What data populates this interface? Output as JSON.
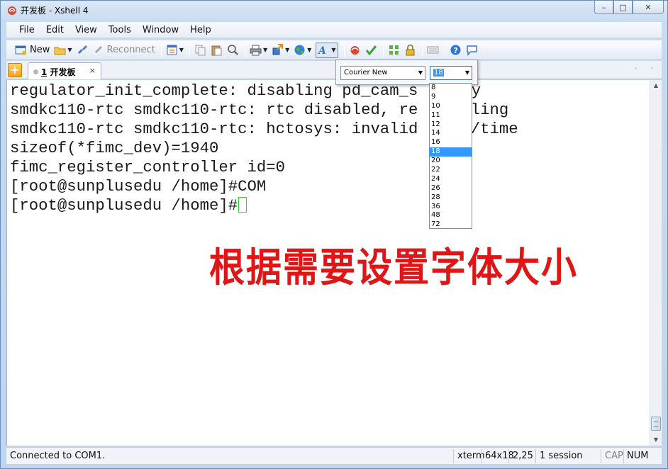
{
  "window": {
    "title": "开发板 - Xshell 4",
    "controls": {
      "minimize": "–",
      "maximize": "□",
      "close": "✕"
    }
  },
  "menu": [
    "File",
    "Edit",
    "View",
    "Tools",
    "Window",
    "Help"
  ],
  "toolbar": {
    "new_label": "New",
    "reconnect_label": "Reconnect"
  },
  "tabs": {
    "add_label": "+",
    "active": {
      "number": "1",
      "name": "开发板",
      "close": "×"
    },
    "nav": "‹ ›"
  },
  "terminal": {
    "lines": [
      "regulator_init_complete: disabling pd_cam_s",
      "smdkc110-rtc smdkc110-rtc: rtc disabled, re",
      "smdkc110-rtc smdkc110-rtc: hctosys: invalid",
      "sizeof(*fimc_dev)=1940",
      "fimc_register_controller id=0",
      "[root@sunplusedu /home]#COM",
      "[root@sunplusedu /home]#"
    ],
    "line_tails": [
      "ty",
      "bling",
      "e/time"
    ],
    "annotation": "根据需要设置字体大小",
    "annotation_color": "#e01515",
    "cursor_color": "#2ecc2e"
  },
  "font_popup": {
    "font_family": "Courier New",
    "font_size": "18",
    "sizes": [
      "8",
      "9",
      "10",
      "11",
      "12",
      "14",
      "16",
      "18",
      "20",
      "22",
      "24",
      "26",
      "28",
      "36",
      "48",
      "72"
    ],
    "selected_size": "18"
  },
  "statusbar": {
    "connection": "Connected to COM1.",
    "terminal_type": "xterm",
    "dimensions": "64x18",
    "cursor_pos": "2,25",
    "sessions": "1 session",
    "caps": "CAP",
    "num": "NUM"
  }
}
